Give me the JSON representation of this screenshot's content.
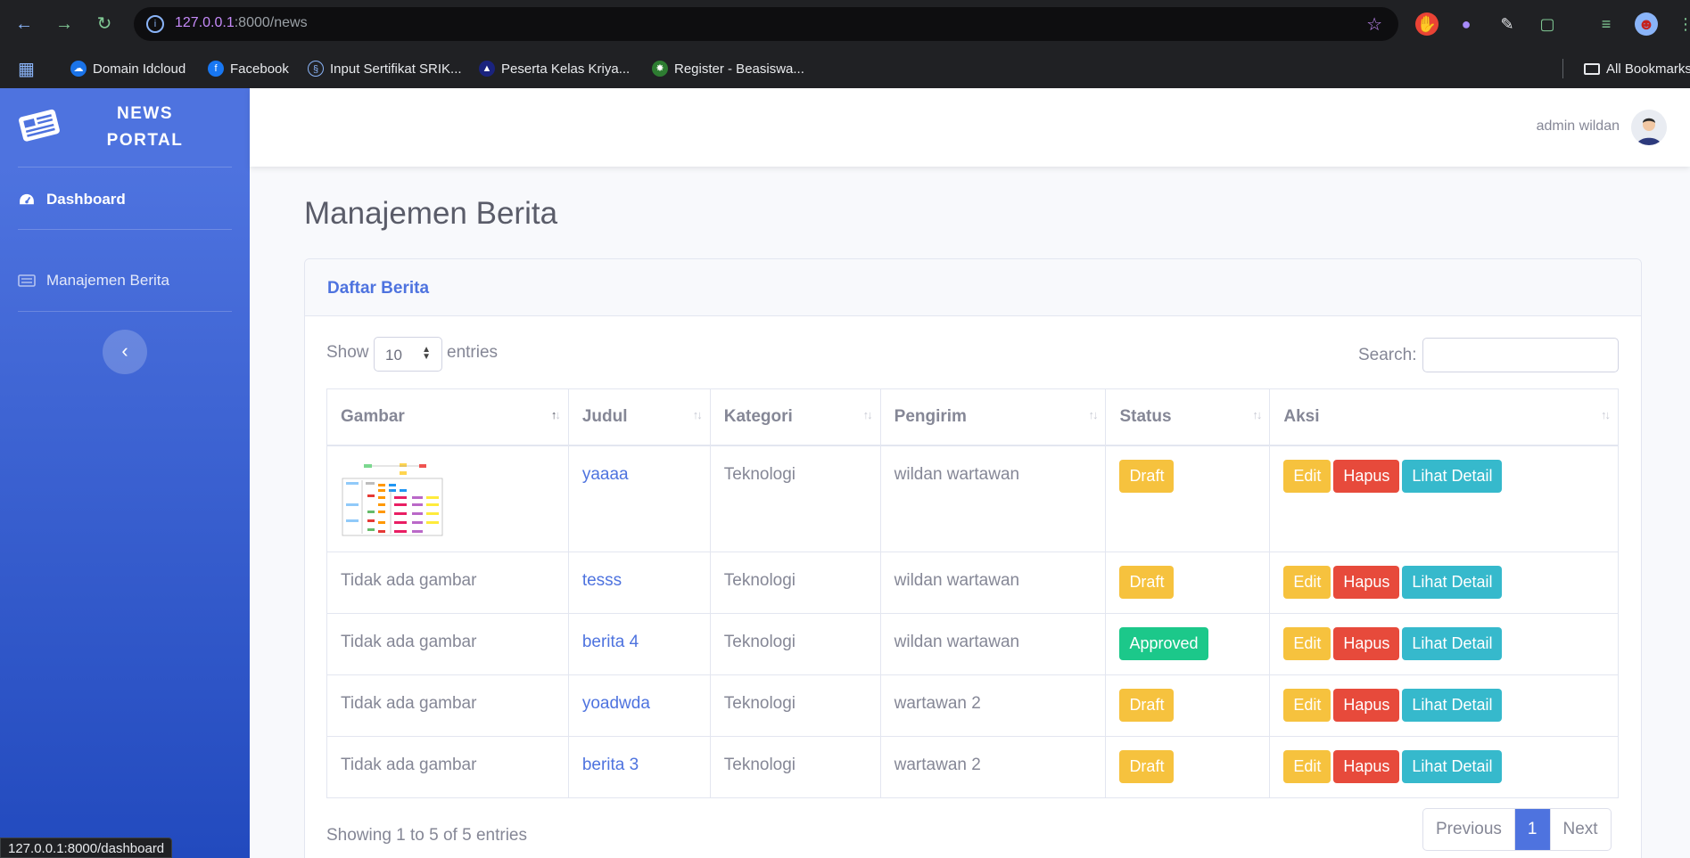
{
  "browser": {
    "url_host": "127.0.0.1",
    "url_path": ":8000/news",
    "bookmarks": [
      "Domain Idcloud",
      "Facebook",
      "Input Sertifikat SRIK...",
      "Peserta Kelas Kriya...",
      "Register - Beasiswa..."
    ],
    "all_bookmarks": "All Bookmarks",
    "status_url": "127.0.0.1:8000/dashboard"
  },
  "sidebar": {
    "brand_line1": "NEWS",
    "brand_line2": "PORTAL",
    "items": [
      {
        "label": "Dashboard",
        "icon": "tachometer-icon"
      },
      {
        "label": "Manajemen Berita",
        "icon": "newspaper-icon"
      }
    ],
    "toggle_icon": "chevron-left-icon"
  },
  "topbar": {
    "user_name": "admin wildan"
  },
  "page": {
    "title": "Manajemen Berita",
    "card_title": "Daftar Berita",
    "show_label": "Show",
    "entries_value": "10",
    "entries_label": "entries",
    "search_label": "Search:",
    "search_value": ""
  },
  "table": {
    "headers": [
      "Gambar",
      "Judul",
      "Kategori",
      "Pengirim",
      "Status",
      "Aksi"
    ],
    "rows": [
      {
        "gambar": "",
        "judul": "yaaaa",
        "kategori": "Teknologi",
        "pengirim": "wildan wartawan",
        "status": "Draft"
      },
      {
        "gambar": "Tidak ada gambar",
        "judul": "tesss",
        "kategori": "Teknologi",
        "pengirim": "wildan wartawan",
        "status": "Draft"
      },
      {
        "gambar": "Tidak ada gambar",
        "judul": "berita 4",
        "kategori": "Teknologi",
        "pengirim": "wildan wartawan",
        "status": "Approved"
      },
      {
        "gambar": "Tidak ada gambar",
        "judul": "yoadwda",
        "kategori": "Teknologi",
        "pengirim": "wartawan 2",
        "status": "Draft"
      },
      {
        "gambar": "Tidak ada gambar",
        "judul": "berita 3",
        "kategori": "Teknologi",
        "pengirim": "wartawan 2",
        "status": "Draft"
      }
    ],
    "actions": {
      "edit": "Edit",
      "delete": "Hapus",
      "detail": "Lihat Detail"
    }
  },
  "footer": {
    "info": "Showing 1 to 5 of 5 entries",
    "previous": "Previous",
    "current_page": "1",
    "next": "Next"
  },
  "colors": {
    "primary": "#4e73df",
    "warning": "#f6c23e",
    "danger": "#e74a3b",
    "info": "#36b9cc",
    "success": "#1cc88a"
  }
}
